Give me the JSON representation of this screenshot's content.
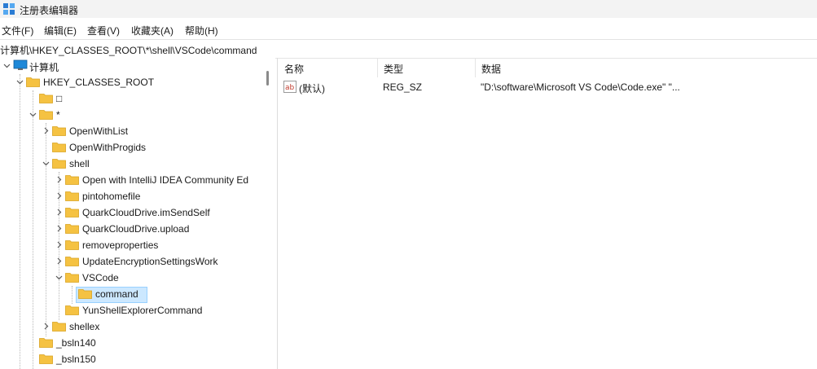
{
  "window": {
    "title": "注册表编辑器"
  },
  "menu": [
    "文件(F)",
    "编辑(E)",
    "查看(V)",
    "收藏夹(A)",
    "帮助(H)"
  ],
  "address": "计算机\\HKEY_CLASSES_ROOT\\*\\shell\\VSCode\\command",
  "tree": {
    "root": "计算机",
    "hkcr": "HKEY_CLASSES_ROOT",
    "unknown_key": "□",
    "star": "*",
    "openwithlist": "OpenWithList",
    "openwithprogids": "OpenWithProgids",
    "shell": "shell",
    "intellij": "Open with IntelliJ IDEA Community Ed",
    "pintohomefile": "pintohomefile",
    "quark_imsendself": "QuarkCloudDrive.imSendSelf",
    "quark_upload": "QuarkCloudDrive.upload",
    "removeproperties": "removeproperties",
    "updateencryption": "UpdateEncryptionSettingsWork",
    "vscode": "VSCode",
    "command": "command",
    "yunshell": "YunShellExplorerCommand",
    "shellex": "shellex",
    "bsln140": "_bsln140",
    "bsln150": "_bsln150"
  },
  "list": {
    "headers": {
      "name": "名称",
      "type": "类型",
      "data": "数据"
    },
    "rows": [
      {
        "name": "(默认)",
        "type": "REG_SZ",
        "data": "\"D:\\software\\Microsoft VS Code\\Code.exe\" \"..."
      }
    ]
  },
  "colors": {
    "folder": "#f5c242",
    "selection": "#cce8ff",
    "selection_border": "#99d1ff"
  },
  "icons": {
    "app": "regedit-icon",
    "computer": "computer-icon",
    "folder": "folder-icon",
    "value": "string-value-icon"
  }
}
